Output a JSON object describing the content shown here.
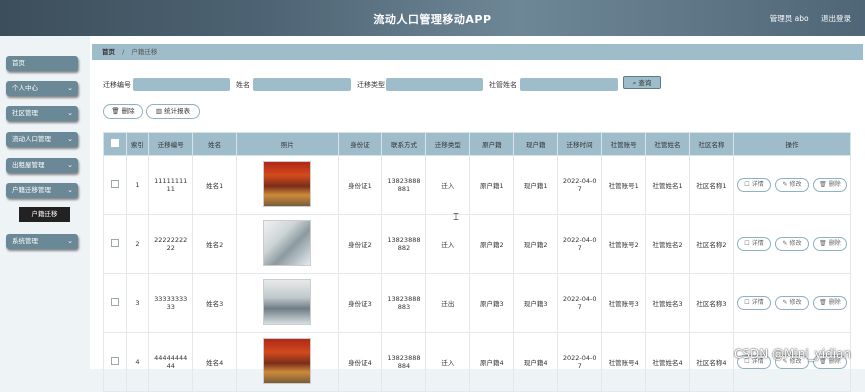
{
  "header": {
    "title": "流动人口管理移动APP",
    "user_label": "管理员 abo",
    "logout_label": "退出登录"
  },
  "sidebar": {
    "items": [
      {
        "label": "首页",
        "chevron": ""
      },
      {
        "label": "个人中心",
        "chevron": "⌄"
      },
      {
        "label": "社区管理",
        "chevron": "⌄"
      },
      {
        "label": "流动人口管理",
        "chevron": "⌄"
      },
      {
        "label": "出租屋管理",
        "chevron": "⌄"
      },
      {
        "label": "户籍迁移管理",
        "chevron": "⌄"
      },
      {
        "label": "系统管理",
        "chevron": "⌄"
      }
    ],
    "active_sub": "户籍迁移"
  },
  "breadcrumb": {
    "home": "首页",
    "sep": "/",
    "current": "户籍迁移"
  },
  "search": {
    "f1_label": "迁移编号",
    "f2_label": "姓名",
    "f3_label": "迁移类型",
    "f4_label": "社管姓名",
    "button_label": "查询",
    "search_icon": "⌕"
  },
  "actions": {
    "delete_label": "删除",
    "report_label": "统计报表",
    "delete_icon": "🗑",
    "report_icon": "▥"
  },
  "table": {
    "headers": [
      "索引",
      "迁移编号",
      "姓名",
      "照片",
      "身份证",
      "联系方式",
      "迁移类型",
      "原户籍",
      "现户籍",
      "迁移时间",
      "社管账号",
      "社管姓名",
      "社区名称",
      "操作"
    ],
    "op_labels": {
      "detail": "详情",
      "edit": "修改",
      "delete": "删除",
      "detail_icon": "☐",
      "edit_icon": "✎",
      "delete_icon": "🗑"
    },
    "rows": [
      {
        "index": "1",
        "code": "1111111111",
        "name": "姓名1",
        "photo": "photo-red",
        "id_card": "身份证1",
        "phone": "13823888881",
        "type": "迁入",
        "origin": "原户籍1",
        "current": "现户籍1",
        "time": "2022-04-07",
        "admin_acc": "社管账号1",
        "admin_name": "社管姓名1",
        "community": "社区名称1"
      },
      {
        "index": "2",
        "code": "2222222222",
        "name": "姓名2",
        "photo": "photo-grey",
        "id_card": "身份证2",
        "phone": "13823888882",
        "type": "迁入",
        "origin": "原户籍2",
        "current": "现户籍2",
        "time": "2022-04-07",
        "admin_acc": "社管账号2",
        "admin_name": "社管姓名2",
        "community": "社区名称2"
      },
      {
        "index": "3",
        "code": "3333333333",
        "name": "姓名3",
        "photo": "photo-hall",
        "id_card": "身份证3",
        "phone": "13823888883",
        "type": "迁出",
        "origin": "原户籍3",
        "current": "现户籍3",
        "time": "2022-04-07",
        "admin_acc": "社管账号3",
        "admin_name": "社管姓名3",
        "community": "社区名称3"
      },
      {
        "index": "4",
        "code": "4444444444",
        "name": "姓名4",
        "photo": "photo-red",
        "id_card": "身份证4",
        "phone": "13823888884",
        "type": "迁入",
        "origin": "原户籍4",
        "current": "现户籍4",
        "time": "2022-04-07",
        "admin_acc": "社管账号4",
        "admin_name": "社管姓名4",
        "community": "社区名称4"
      }
    ]
  },
  "watermark": "CSDN @Mini_yidian",
  "colors": {
    "accent": "#9fbccb",
    "sidebar_item": "#6b8896",
    "header_dark": "#3c4e5a"
  }
}
